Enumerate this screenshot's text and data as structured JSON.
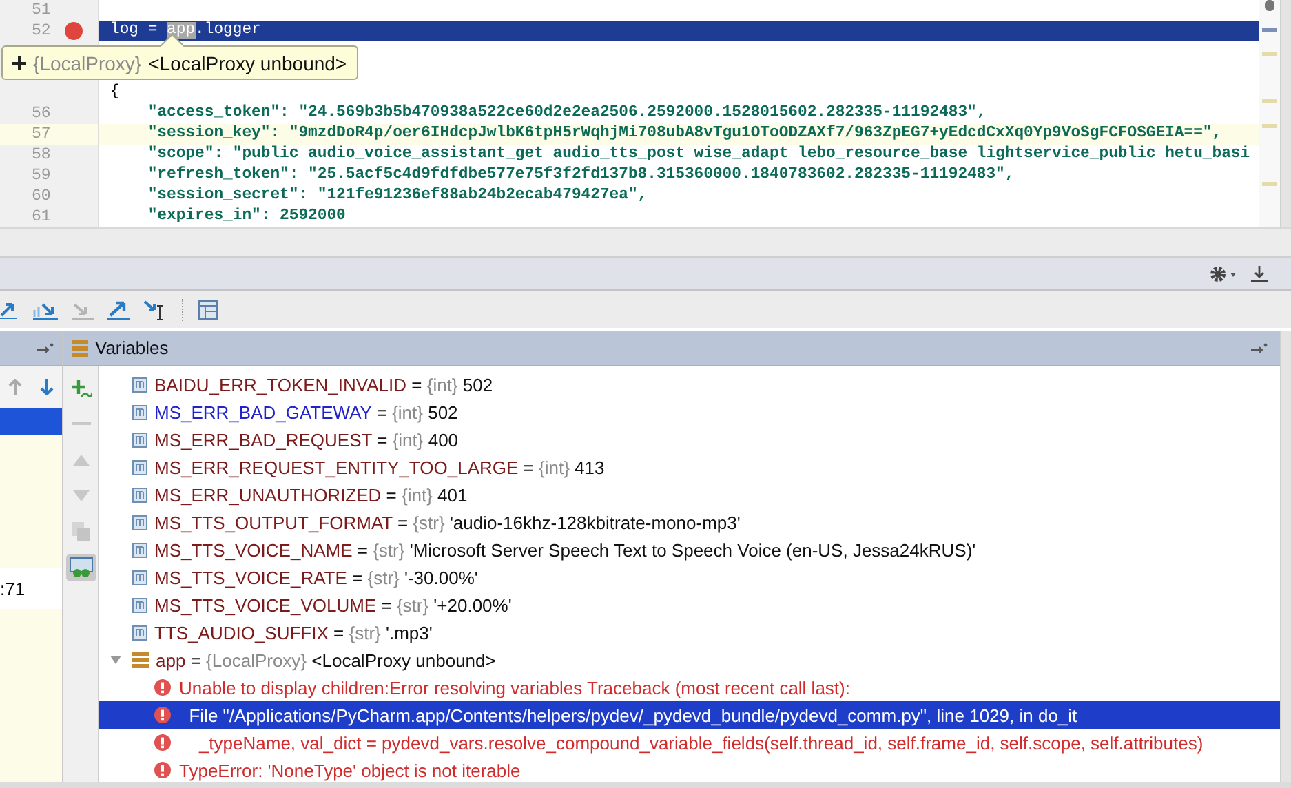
{
  "editor": {
    "lines": [
      {
        "number": "51",
        "breakpoint": false,
        "execution_point": false,
        "caret_line": false
      },
      {
        "number": "52",
        "breakpoint": true,
        "execution_point": true,
        "caret_line": false,
        "tokens": [
          {
            "text": "log = ",
            "kind": "plain"
          },
          {
            "text": "app",
            "kind": "match"
          },
          {
            "text": ".logger",
            "kind": "plain"
          }
        ]
      },
      {
        "breakpoint": false,
        "execution_point": false,
        "caret_line": false
      },
      {
        "breakpoint": false,
        "execution_point": false,
        "caret_line": false
      },
      {
        "breakpoint": false,
        "execution_point": false,
        "caret_line": false,
        "tokens": [
          {
            "text": "{",
            "kind": "plain"
          }
        ]
      },
      {
        "number": "56",
        "breakpoint": false,
        "execution_point": false,
        "caret_line": false,
        "tokens": [
          {
            "text": "    \"access_token\": \"24.569b3b5b470938a522ce60d2e2ea2506.2592000.1528015602.282335-11192483\",",
            "kind": "string"
          }
        ]
      },
      {
        "number": "57",
        "breakpoint": false,
        "execution_point": false,
        "caret_line": true,
        "tokens": [
          {
            "text": "    \"session_key\": \"9mzdDoR4p/oer6IHdcpJwlbK6tpH5rWqhjMi708ubA8vTgu1OToODZAXf7/963ZpEG7+yEdcdCxXq0Yp9VoSgFCFOSGEIA==\",",
            "kind": "string"
          }
        ]
      },
      {
        "number": "58",
        "breakpoint": false,
        "execution_point": false,
        "caret_line": false,
        "tokens": [
          {
            "text": "    \"scope\": \"public audio_voice_assistant_get audio_tts_post wise_adapt lebo_resource_base lightservice_public hetu_basi",
            "kind": "string"
          }
        ]
      },
      {
        "number": "59",
        "breakpoint": false,
        "execution_point": false,
        "caret_line": false,
        "tokens": [
          {
            "text": "    \"refresh_token\": \"25.5acf5c4d9fdfdbe577e75f3f2fd137b8.315360000.1840783602.282335-11192483\",",
            "kind": "string"
          }
        ]
      },
      {
        "number": "60",
        "breakpoint": false,
        "execution_point": false,
        "caret_line": false,
        "tokens": [
          {
            "text": "    \"session_secret\": \"121fe91236ef88ab24b2ecab479427ea\",",
            "kind": "string"
          }
        ]
      },
      {
        "number": "61",
        "breakpoint": false,
        "execution_point": false,
        "caret_line": false,
        "tokens": [
          {
            "text": "    \"expires_in\": 2592000",
            "kind": "string"
          }
        ]
      }
    ]
  },
  "tooltip": {
    "type": "{LocalProxy}",
    "value": "<LocalProxy unbound>"
  },
  "frames": {
    "rows": [
      {
        "selected": true,
        "kind": "library"
      },
      {
        "selected": false,
        "kind": "library"
      },
      {
        "selected": false,
        "kind": "user",
        "text": ":71"
      },
      {
        "selected": false,
        "kind": "library"
      }
    ]
  },
  "variables": {
    "title": "Variables",
    "side_buttons": [
      {
        "kind": "add",
        "disabled": false,
        "selected": false
      },
      {
        "kind": "remove",
        "disabled": true,
        "selected": false
      },
      {
        "kind": "up",
        "disabled": true,
        "selected": false
      },
      {
        "kind": "down",
        "disabled": true,
        "selected": false
      },
      {
        "kind": "copy",
        "disabled": true,
        "selected": false
      },
      {
        "kind": "watch",
        "disabled": false,
        "selected": true
      }
    ],
    "items": [
      {
        "kind": "field",
        "name": "BAIDU_ERR_TOKEN_INVALID",
        "operator": "=",
        "type": "{int}",
        "value": "502",
        "changed": false
      },
      {
        "kind": "field",
        "name": "MS_ERR_BAD_GATEWAY",
        "operator": "=",
        "type": "{int}",
        "value": "502",
        "changed": true
      },
      {
        "kind": "field",
        "name": "MS_ERR_BAD_REQUEST",
        "operator": "=",
        "type": "{int}",
        "value": "400",
        "changed": false
      },
      {
        "kind": "field",
        "name": "MS_ERR_REQUEST_ENTITY_TOO_LARGE",
        "operator": "=",
        "type": "{int}",
        "value": "413",
        "changed": false
      },
      {
        "kind": "field",
        "name": "MS_ERR_UNAUTHORIZED",
        "operator": "=",
        "type": "{int}",
        "value": "401",
        "changed": false
      },
      {
        "kind": "field",
        "name": "MS_TTS_OUTPUT_FORMAT",
        "operator": "=",
        "type": "{str}",
        "value": "'audio-16khz-128kbitrate-mono-mp3'",
        "changed": false
      },
      {
        "kind": "field",
        "name": "MS_TTS_VOICE_NAME",
        "operator": "=",
        "type": "{str}",
        "value": "'Microsoft Server Speech Text to Speech Voice (en-US, Jessa24kRUS)'",
        "changed": false
      },
      {
        "kind": "field",
        "name": "MS_TTS_VOICE_RATE",
        "operator": "=",
        "type": "{str}",
        "value": "'-30.00%'",
        "changed": false
      },
      {
        "kind": "field",
        "name": "MS_TTS_VOICE_VOLUME",
        "operator": "=",
        "type": "{str}",
        "value": "'+20.00%'",
        "changed": false
      },
      {
        "kind": "field",
        "name": "TTS_AUDIO_SUFFIX",
        "operator": "=",
        "type": "{str}",
        "value": "'.mp3'",
        "changed": false
      },
      {
        "kind": "object",
        "name": "app",
        "operator": "=",
        "type": "{LocalProxy}",
        "value": "<LocalProxy unbound>",
        "changed": false,
        "expanded": true,
        "children": [
          {
            "text": "Unable to display children:Error resolving variables Traceback (most recent call last):",
            "selected": false
          },
          {
            "text": "  File \"/Applications/PyCharm.app/Contents/helpers/pydev/_pydevd_bundle/pydevd_comm.py\", line 1029, in do_it",
            "selected": true
          },
          {
            "text": "    _typeName, val_dict = pydevd_vars.resolve_compound_variable_fields(self.thread_id, self.frame_id, self.scope, self.attributes)",
            "selected": false
          },
          {
            "text": "TypeError: 'NoneType' object is not iterable",
            "selected": false
          }
        ]
      }
    ]
  }
}
